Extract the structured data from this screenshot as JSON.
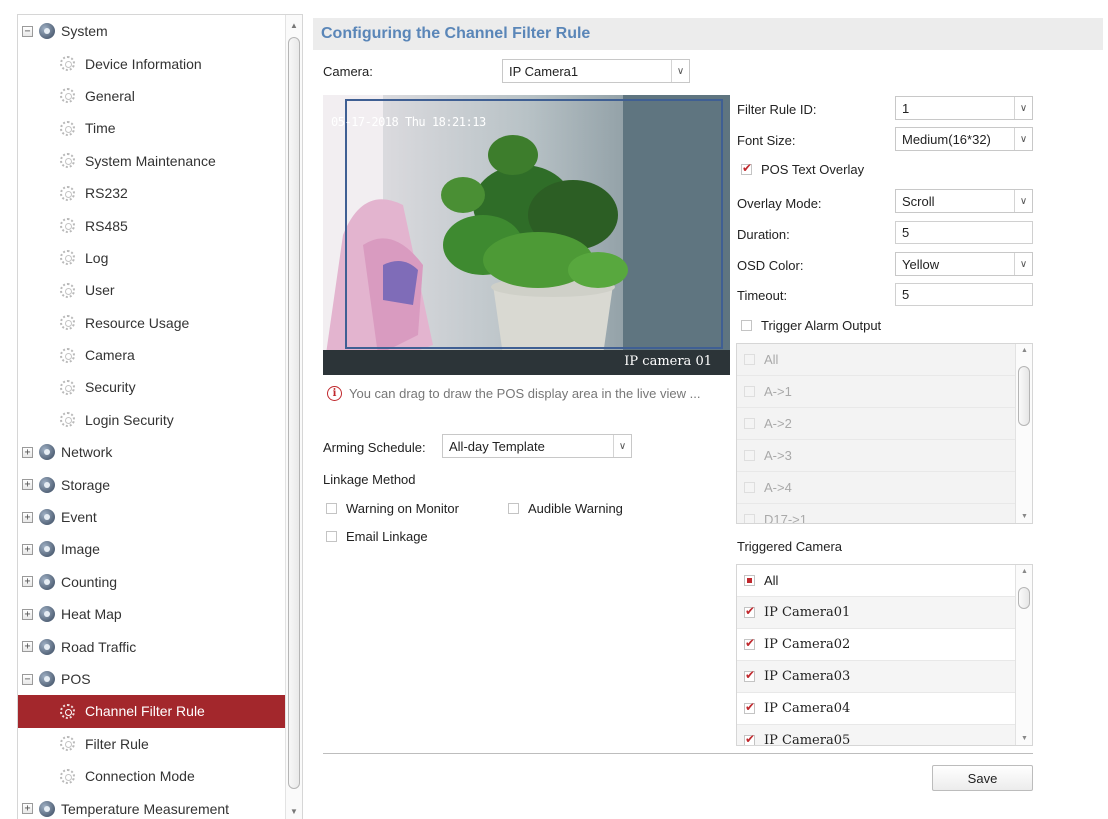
{
  "sidebar": {
    "items": [
      {
        "label": "System",
        "level": "top",
        "expander": "−"
      },
      {
        "label": "Device Information",
        "level": "child"
      },
      {
        "label": "General",
        "level": "child"
      },
      {
        "label": "Time",
        "level": "child"
      },
      {
        "label": "System Maintenance",
        "level": "child"
      },
      {
        "label": "RS232",
        "level": "child"
      },
      {
        "label": "RS485",
        "level": "child"
      },
      {
        "label": "Log",
        "level": "child"
      },
      {
        "label": "User",
        "level": "child"
      },
      {
        "label": "Resource Usage",
        "level": "child"
      },
      {
        "label": "Camera",
        "level": "child"
      },
      {
        "label": "Security",
        "level": "child"
      },
      {
        "label": "Login Security",
        "level": "child"
      },
      {
        "label": "Network",
        "level": "top",
        "expander": "+"
      },
      {
        "label": "Storage",
        "level": "top",
        "expander": "+"
      },
      {
        "label": "Event",
        "level": "top",
        "expander": "+"
      },
      {
        "label": "Image",
        "level": "top",
        "expander": "+"
      },
      {
        "label": "Counting",
        "level": "top",
        "expander": "+"
      },
      {
        "label": "Heat Map",
        "level": "top",
        "expander": "+"
      },
      {
        "label": "Road Traffic",
        "level": "top",
        "expander": "+"
      },
      {
        "label": "POS",
        "level": "top",
        "expander": "−"
      },
      {
        "label": "Channel Filter Rule",
        "level": "child",
        "selected": true
      },
      {
        "label": "Filter Rule",
        "level": "child"
      },
      {
        "label": "Connection Mode",
        "level": "child"
      },
      {
        "label": "Temperature Measurement",
        "level": "top",
        "expander": "+"
      }
    ]
  },
  "header": {
    "title": "Configuring the Channel Filter Rule"
  },
  "camera": {
    "label": "Camera:",
    "value": "IP Camera1"
  },
  "video": {
    "osd_time": "05-17-2018 Thu 18:21:13",
    "osd_name": "IP camera 01"
  },
  "hint": {
    "text": "You can drag to draw the POS display area in the live view ..."
  },
  "arming": {
    "label": "Arming Schedule:",
    "value": "All-day Template"
  },
  "linkage": {
    "title": "Linkage Method",
    "warning_on_monitor": "Warning on Monitor",
    "audible_warning": "Audible Warning",
    "email_linkage": "Email Linkage"
  },
  "settings": {
    "filter_rule_id_label": "Filter Rule ID:",
    "filter_rule_id": "1",
    "font_size_label": "Font Size:",
    "font_size": "Medium(16*32)",
    "pos_text_overlay": "POS Text Overlay",
    "overlay_mode_label": "Overlay Mode:",
    "overlay_mode": "Scroll",
    "duration_label": "Duration:",
    "duration": "5",
    "osd_color_label": "OSD Color:",
    "osd_color": "Yellow",
    "timeout_label": "Timeout:",
    "timeout": "5",
    "trigger_alarm_output": "Trigger Alarm Output"
  },
  "alarm_outputs": [
    "All",
    "A->1",
    "A->2",
    "A->3",
    "A->4",
    "D17->1"
  ],
  "triggered_camera": {
    "title": "Triggered Camera",
    "items": [
      "All",
      "IP Camera01",
      "IP Camera02",
      "IP Camera03",
      "IP Camera04",
      "IP Camera05"
    ]
  },
  "save_label": "Save",
  "colors": {
    "accent": "#a3272c",
    "title": "#5a86b8",
    "check": "#c0282d"
  }
}
